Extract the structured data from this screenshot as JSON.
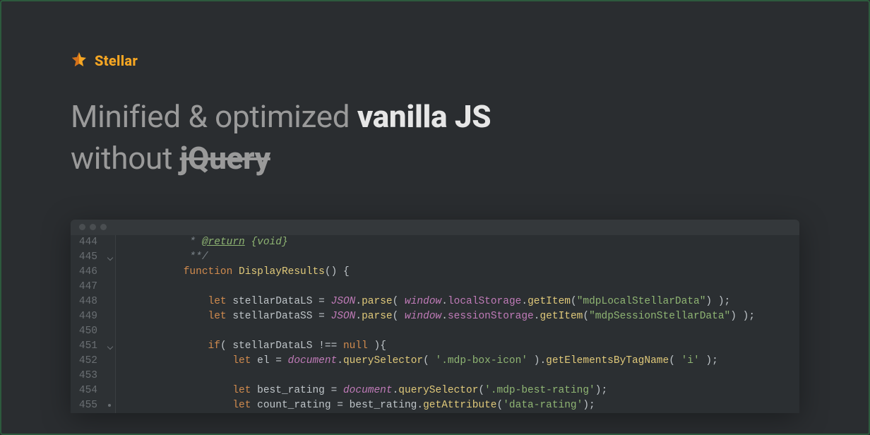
{
  "brand": {
    "name": "Stellar"
  },
  "headline": {
    "prefix": "Minified & optimized ",
    "bold": "vanilla JS",
    "line2_prefix": "without ",
    "strike": "jQuery"
  },
  "editor": {
    "lines": [
      {
        "n": "444",
        "g": "",
        "html": "            <span class='c-comment'>*</span> <span class='c-doc-u'>@return</span> <span class='c-doc'>{void}</span>"
      },
      {
        "n": "445",
        "g": "mark",
        "html": "            <span class='c-comment'>**/</span>"
      },
      {
        "n": "446",
        "g": "",
        "html": "           <span class='c-kw'>function</span> <span class='c-fn'>DisplayResults</span><span class='c-punc'>() {</span>"
      },
      {
        "n": "447",
        "g": "",
        "html": ""
      },
      {
        "n": "448",
        "g": "",
        "html": "               <span class='c-let'>let</span> <span class='c-var'>stellarDataLS</span> <span class='c-punc'>=</span> <span class='c-obj'>JSON</span><span class='c-punc'>.</span><span class='c-method'>parse</span><span class='c-punc'>( </span><span class='c-builtin'>window</span><span class='c-punc'>.</span><span class='c-prop'>localStorage</span><span class='c-punc'>.</span><span class='c-method'>getItem</span><span class='c-punc'>(</span><span class='c-str'>\"mdpLocalStellarData\"</span><span class='c-punc'>) );</span>"
      },
      {
        "n": "449",
        "g": "",
        "html": "               <span class='c-let'>let</span> <span class='c-var'>stellarDataSS</span> <span class='c-punc'>=</span> <span class='c-obj'>JSON</span><span class='c-punc'>.</span><span class='c-method'>parse</span><span class='c-punc'>( </span><span class='c-builtin'>window</span><span class='c-punc'>.</span><span class='c-prop'>sessionStorage</span><span class='c-punc'>.</span><span class='c-method'>getItem</span><span class='c-punc'>(</span><span class='c-str'>\"mdpSessionStellarData\"</span><span class='c-punc'>) );</span>"
      },
      {
        "n": "450",
        "g": "",
        "html": ""
      },
      {
        "n": "451",
        "g": "mark",
        "html": "               <span class='c-kw'>if</span><span class='c-punc'>( </span><span class='c-var'>stellarDataLS</span> <span class='c-punc'>!==</span> <span class='c-kw'>null</span> <span class='c-punc'>){</span>"
      },
      {
        "n": "452",
        "g": "",
        "html": "                   <span class='c-let'>let</span> <span class='c-var'>el</span> <span class='c-punc'>=</span> <span class='c-builtin'>document</span><span class='c-punc'>.</span><span class='c-method'>querySelector</span><span class='c-punc'>( </span><span class='c-str'>'.mdp-box-icon'</span> <span class='c-punc'>).</span><span class='c-method'>getElementsByTagName</span><span class='c-punc'>( </span><span class='c-str'>'i'</span> <span class='c-punc'>);</span>"
      },
      {
        "n": "453",
        "g": "",
        "html": ""
      },
      {
        "n": "454",
        "g": "",
        "html": "                   <span class='c-let'>let</span> <span class='c-var'>best_rating</span> <span class='c-punc'>=</span> <span class='c-builtin'>document</span><span class='c-punc'>.</span><span class='c-method'>querySelector</span><span class='c-punc'>(</span><span class='c-str'>'.mdp-best-rating'</span><span class='c-punc'>);</span>"
      },
      {
        "n": "455",
        "g": "dot",
        "html": "                   <span class='c-let'>let</span> <span class='c-var'>count_rating</span> <span class='c-punc'>=</span> <span class='c-var'>best_rating</span><span class='c-punc'>.</span><span class='c-method'>getAttribute</span><span class='c-punc'>(</span><span class='c-str'>'data-rating'</span><span class='c-punc'>);</span>"
      }
    ]
  }
}
